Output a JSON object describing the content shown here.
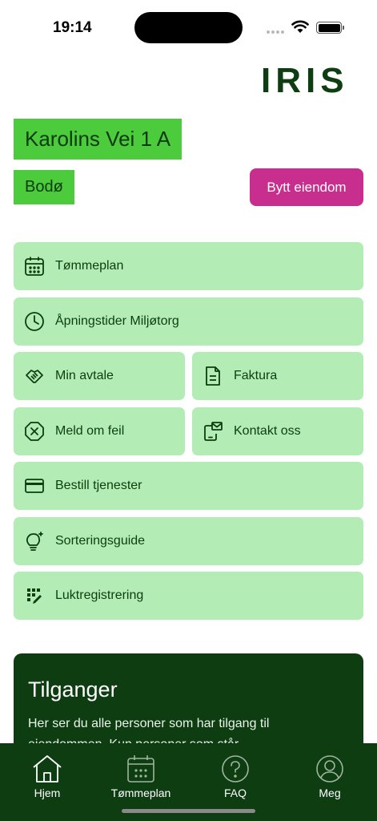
{
  "status_bar": {
    "time": "19:14"
  },
  "brand": {
    "logo_text": "IRIS",
    "color": "#0f3d12"
  },
  "property": {
    "address": "Karolins Vei 1 A",
    "city": "Bodø",
    "switch_label": "Bytt eiendom"
  },
  "menu": {
    "schedule": {
      "label": "Tømmeplan",
      "icon": "calendar-icon"
    },
    "opening_hours": {
      "label": "Åpningstider Miljøtorg",
      "icon": "clock-icon"
    },
    "agreement": {
      "label": "Min avtale",
      "icon": "handshake-icon"
    },
    "invoice": {
      "label": "Faktura",
      "icon": "document-icon"
    },
    "report_error": {
      "label": "Meld om feil",
      "icon": "close-circle-icon"
    },
    "contact": {
      "label": "Kontakt oss",
      "icon": "phone-mail-icon"
    },
    "order_services": {
      "label": "Bestill tjenester",
      "icon": "card-icon"
    },
    "sorting_guide": {
      "label": "Sorteringsguide",
      "icon": "lightbulb-icon"
    },
    "odor": {
      "label": "Luktregistrering",
      "icon": "grid-pencil-icon"
    }
  },
  "access": {
    "title": "Tilganger",
    "text": "Her ser du alle personer som har tilgang til eiendommen. Kun personer som står"
  },
  "tabs": [
    {
      "label": "Hjem",
      "icon": "home-icon"
    },
    {
      "label": "Tømmeplan",
      "icon": "calendar-icon"
    },
    {
      "label": "FAQ",
      "icon": "question-icon"
    },
    {
      "label": "Meg",
      "icon": "user-icon"
    }
  ],
  "colors": {
    "accent_green": "#4ccb3c",
    "tile_green": "#b3edb5",
    "dark_green": "#0f3d12",
    "magenta": "#c82e8d"
  }
}
